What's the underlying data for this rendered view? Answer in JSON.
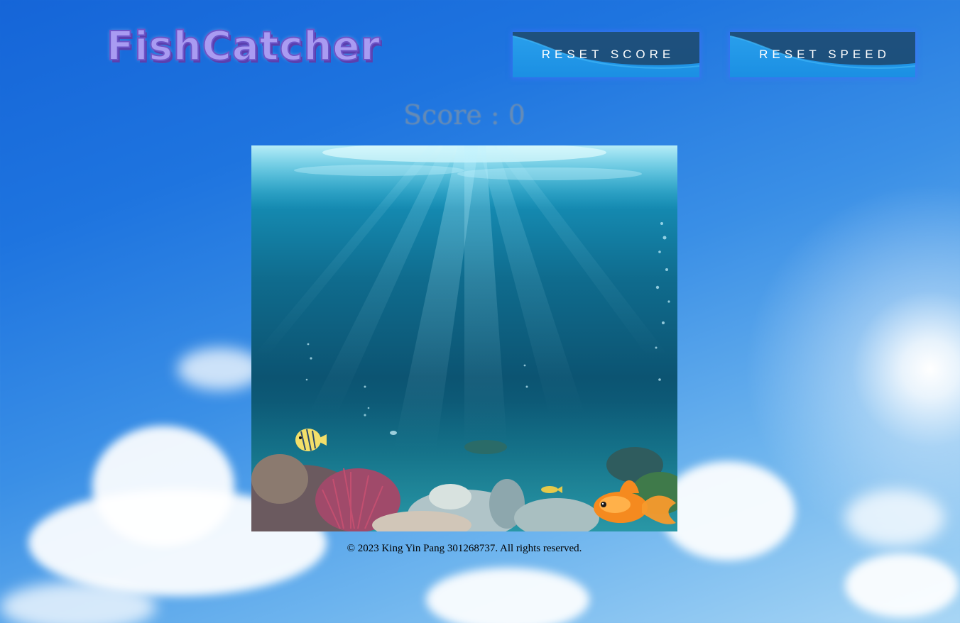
{
  "header": {
    "title": "FishCatcher",
    "reset_score_label": "RESET SCORE",
    "reset_speed_label": "RESET SPEED"
  },
  "score": {
    "text": "Score : 0",
    "value": 0
  },
  "footer": {
    "copyright": "© 2023 King Yin Pang 301268737. All rights reserved."
  },
  "game": {
    "scene": "underwater-coral-reef",
    "fish": [
      "butterflyfish",
      "goldfish",
      "small-yellow-fish"
    ]
  },
  "colors": {
    "title_fill": "#a99bf2",
    "title_shadow": "#5b3fae",
    "button_bg": "#1b8fe3",
    "button_wave": "#1d4a73",
    "sky_top": "#1565d8",
    "sky_bottom": "#a8d6f5"
  }
}
